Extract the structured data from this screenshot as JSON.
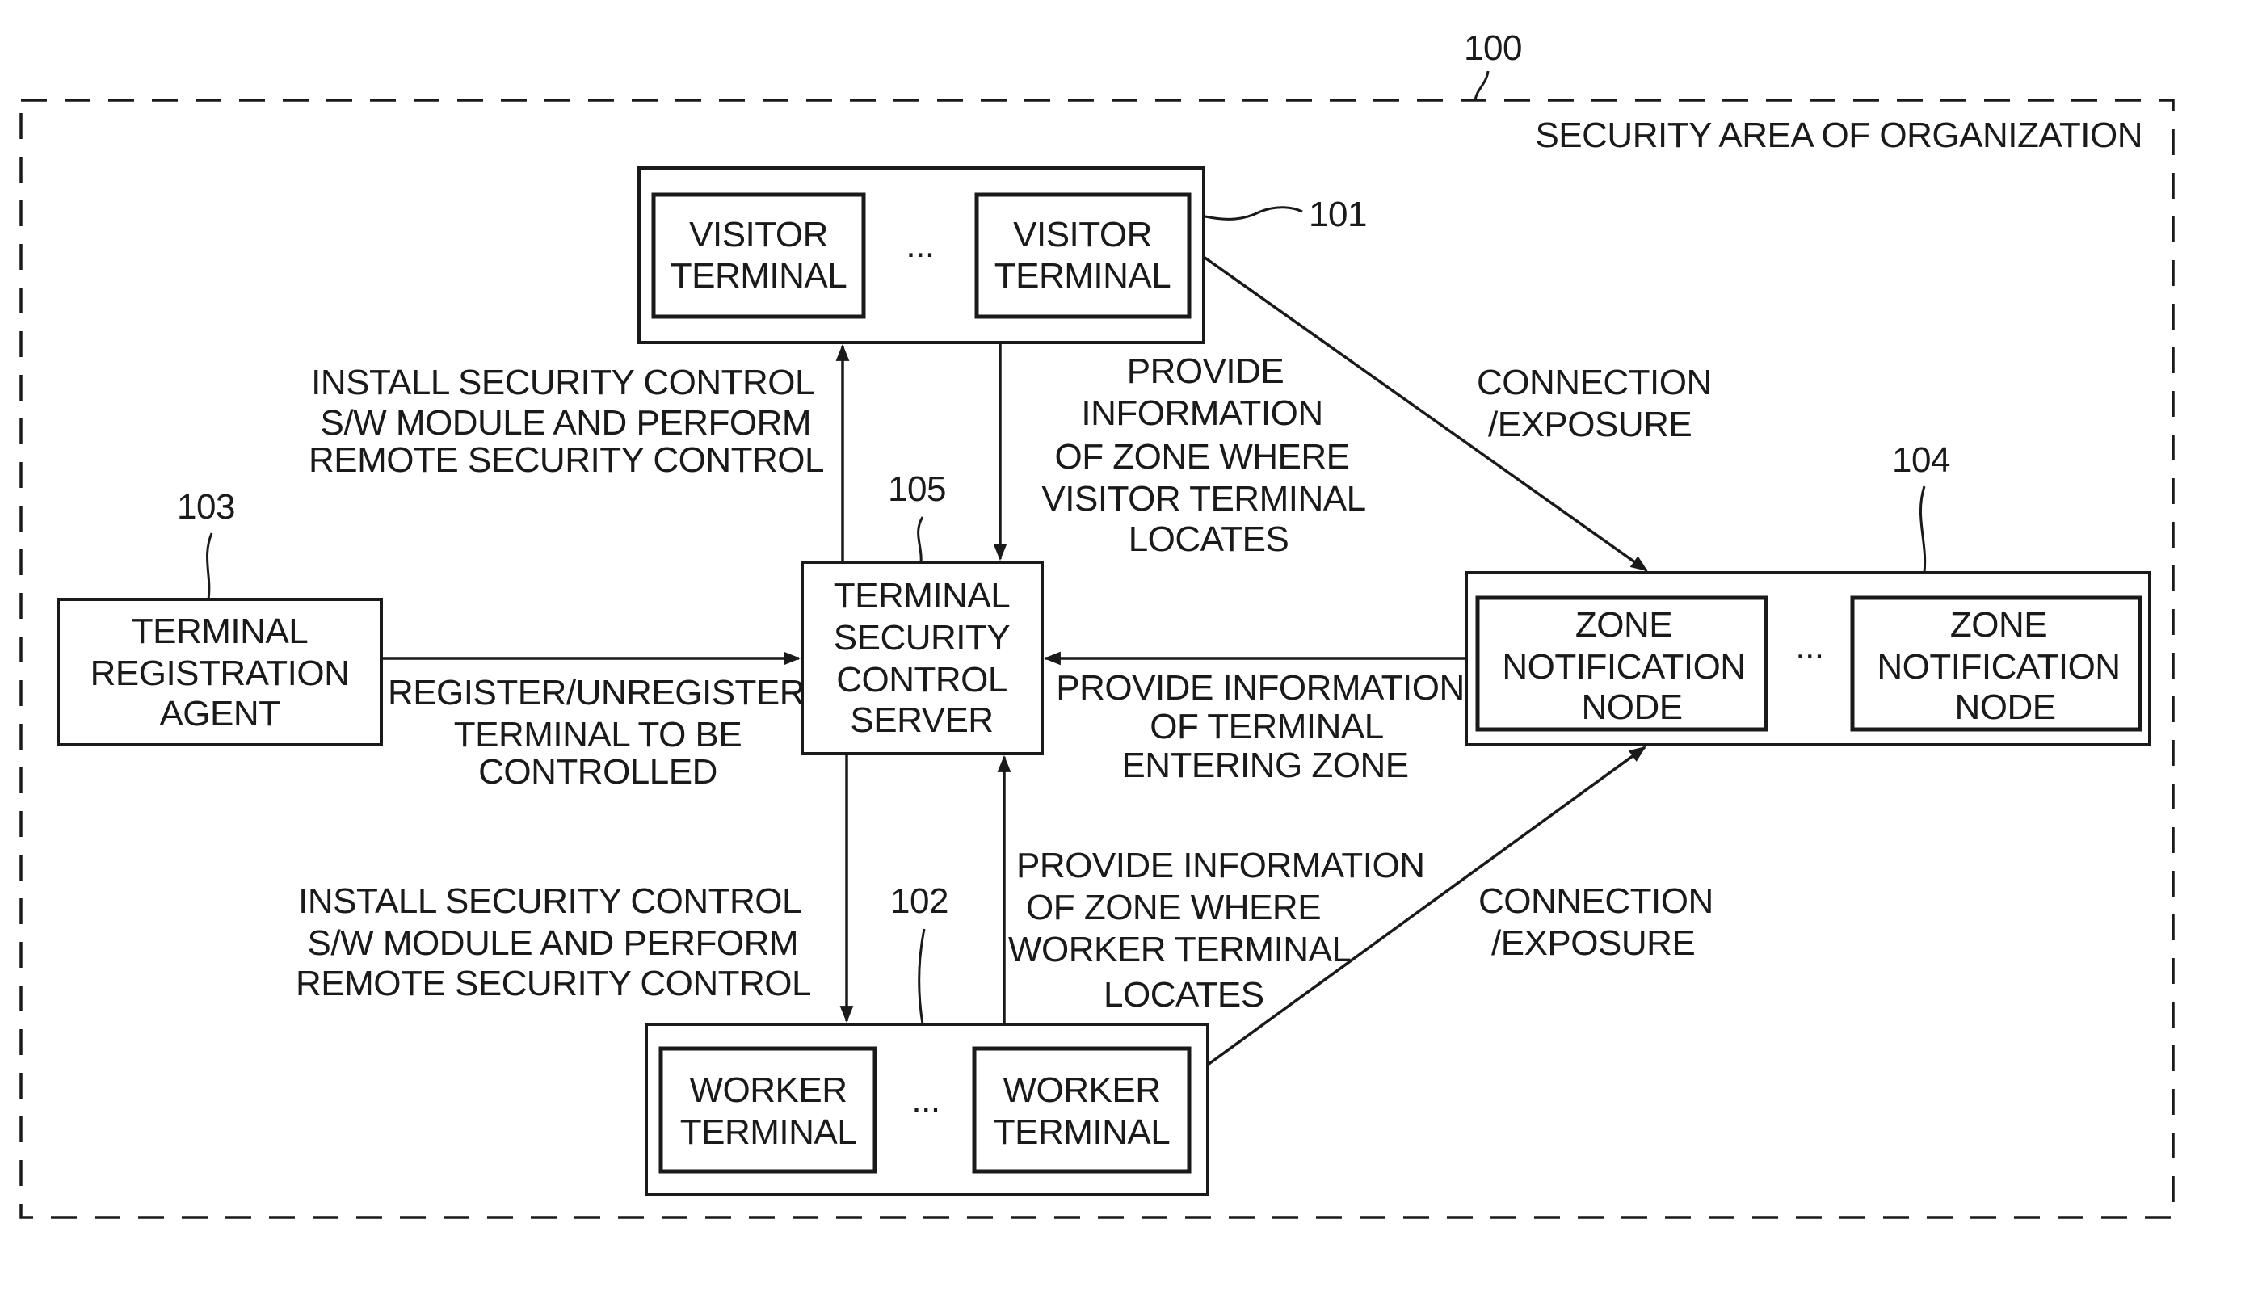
{
  "figure": {
    "area_ref": "100",
    "area_label": "SECURITY AREA OF ORGANIZATION"
  },
  "visitor_group": {
    "ref": "101",
    "terminals": [
      {
        "lines": [
          "VISITOR",
          "TERMINAL"
        ]
      },
      {
        "lines": [
          "VISITOR",
          "TERMINAL"
        ]
      }
    ],
    "ellipsis": "..."
  },
  "worker_group": {
    "ref": "102",
    "terminals": [
      {
        "lines": [
          "WORKER",
          "TERMINAL"
        ]
      },
      {
        "lines": [
          "WORKER",
          "TERMINAL"
        ]
      }
    ],
    "ellipsis": "..."
  },
  "registration_agent": {
    "ref": "103",
    "lines": [
      "TERMINAL",
      "REGISTRATION",
      "AGENT"
    ]
  },
  "zone_group": {
    "ref": "104",
    "nodes": [
      {
        "lines": [
          "ZONE",
          "NOTIFICATION",
          "NODE"
        ]
      },
      {
        "lines": [
          "ZONE",
          "NOTIFICATION",
          "NODE"
        ]
      }
    ],
    "ellipsis": "..."
  },
  "server": {
    "ref": "105",
    "lines": [
      "TERMINAL",
      "SECURITY",
      "CONTROL",
      "SERVER"
    ]
  },
  "edges": {
    "install_visitor": [
      "INSTALL SECURITY CONTROL",
      "S/W MODULE AND PERFORM",
      "REMOTE SECURITY CONTROL"
    ],
    "visitor_zone_info": [
      "PROVIDE",
      "INFORMATION",
      "OF ZONE WHERE",
      "VISITOR TERMINAL",
      "LOCATES"
    ],
    "visitor_connection": [
      "CONNECTION",
      "/EXPOSURE"
    ],
    "register": [
      "REGISTER/UNREGISTER",
      "TERMINAL TO BE",
      "CONTROLLED"
    ],
    "zone_entering_info": [
      "PROVIDE INFORMATION",
      "OF TERMINAL",
      "ENTERING ZONE"
    ],
    "install_worker": [
      "INSTALL SECURITY CONTROL",
      "S/W MODULE AND PERFORM",
      "REMOTE SECURITY CONTROL"
    ],
    "worker_zone_info": [
      "PROVIDE INFORMATION",
      "OF ZONE WHERE",
      "WORKER TERMINAL",
      "LOCATES"
    ],
    "worker_connection": [
      "CONNECTION",
      "/EXPOSURE"
    ]
  }
}
